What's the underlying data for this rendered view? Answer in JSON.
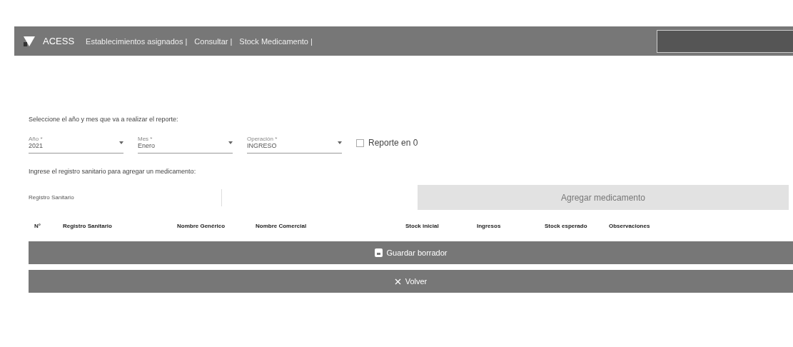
{
  "navbar": {
    "brand": "ACESS",
    "links": [
      "Establecimientos asignados |",
      "Consultar |",
      "Stock Medicamento |"
    ]
  },
  "period": {
    "instruction": "Seleccione el año y mes que va a realizar el reporte:",
    "selects": [
      {
        "label": "Año *",
        "value": "2021"
      },
      {
        "label": "Mes *",
        "value": "Enero"
      },
      {
        "label": "Operación *",
        "value": "INGRESO"
      }
    ],
    "zero_report": {
      "label": "Reporte en 0",
      "checked": false
    }
  },
  "add": {
    "instruction": "Ingrese el registro sanitario para agregar un medicamento:",
    "placeholder": "Registro Sanitario",
    "button": {
      "label": "Agregar medicamento",
      "disabled": true
    }
  },
  "table": {
    "columns": [
      "N°",
      "Registro Sanitario",
      "Nombre Genérico",
      "Nombre Comercial",
      "Stock inicial",
      "Ingresos",
      "Stock esperado",
      "Observaciones"
    ]
  },
  "buttons": [
    {
      "kind": "save",
      "label": "Guardar borrador"
    },
    {
      "kind": "back",
      "label": "Volver"
    }
  ]
}
